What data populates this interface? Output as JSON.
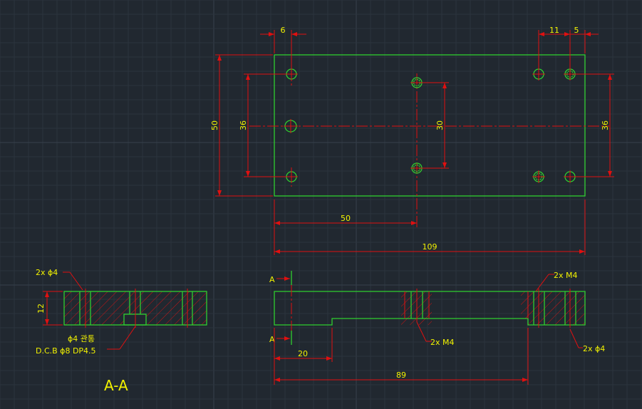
{
  "colors": {
    "background": "#212830",
    "outline": "#2fcf2f",
    "dimension": "#e01010",
    "text": "#f2f200"
  },
  "top_view": {
    "dims": {
      "hole_offset_left": "6",
      "hole_spacing_right": "11",
      "hole_offset_right": "5",
      "height": "50",
      "left_hole_span": "36",
      "center_hole_span": "30",
      "right_hole_span": "36",
      "center_hole_x": "50",
      "width": "109"
    }
  },
  "section_view": {
    "label_a_top": "A",
    "label_a_bottom": "A",
    "callout_left_holes": "2x ϕ4",
    "callout_center_holes": "2x M4",
    "callout_right_top": "2x M4",
    "callout_right_bottom": "2x ϕ4",
    "dim_step_start": "20",
    "dim_step_length": "89"
  },
  "side_view": {
    "callout_top": "2x ϕ4",
    "height_dim": "12",
    "note_through": "ϕ4 관통",
    "note_counterbore": "D.C.B ϕ8 DP4.5",
    "section_title": "A-A"
  }
}
